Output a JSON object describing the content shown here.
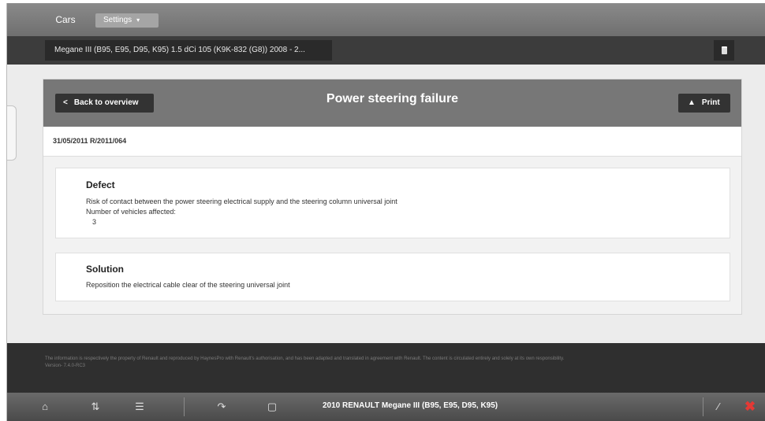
{
  "topbar": {
    "tab_cars": "Cars",
    "settings_label": "Settings",
    "settings_caret": "▾"
  },
  "vehicle": {
    "selected": "Megane III (B95, E95, D95, K95) 1.5 dCi 105 (K9K-832 (G8)) 2008 - 2..."
  },
  "header": {
    "back_label": "Back to overview",
    "title": "Power steering failure",
    "print_label": "Print"
  },
  "reference": "31/05/2011 R/2011/064",
  "defect": {
    "title": "Defect",
    "description": "Risk of contact between the power steering electrical supply and the steering column universal joint",
    "affected_label": "Number of vehicles affected:",
    "affected_count": "3"
  },
  "solution": {
    "title": "Solution",
    "description": "Reposition the electrical cable clear of the steering universal joint"
  },
  "footer": {
    "disclaimer": "The information is respectively the property of Renault and reproduced by HaynesPro with Renault's authorisation, and has been adapted and translated in agreement with Renault. The content is circulated entirely and solely at its own responsibility.",
    "version": "Version- 7.4.0-RC3"
  },
  "toolbar": {
    "vehicle_title": "2010 RENAULT Megane III (B95, E95, D95, K95)",
    "icons": [
      "home-icon",
      "collapse-icon",
      "list-icon",
      "transfer-icon",
      "folder-icon",
      "tools-icon",
      "close-icon"
    ]
  },
  "colors": {
    "header_bg": "#777777",
    "dark_button": "#333333",
    "close_red": "#e53935"
  }
}
